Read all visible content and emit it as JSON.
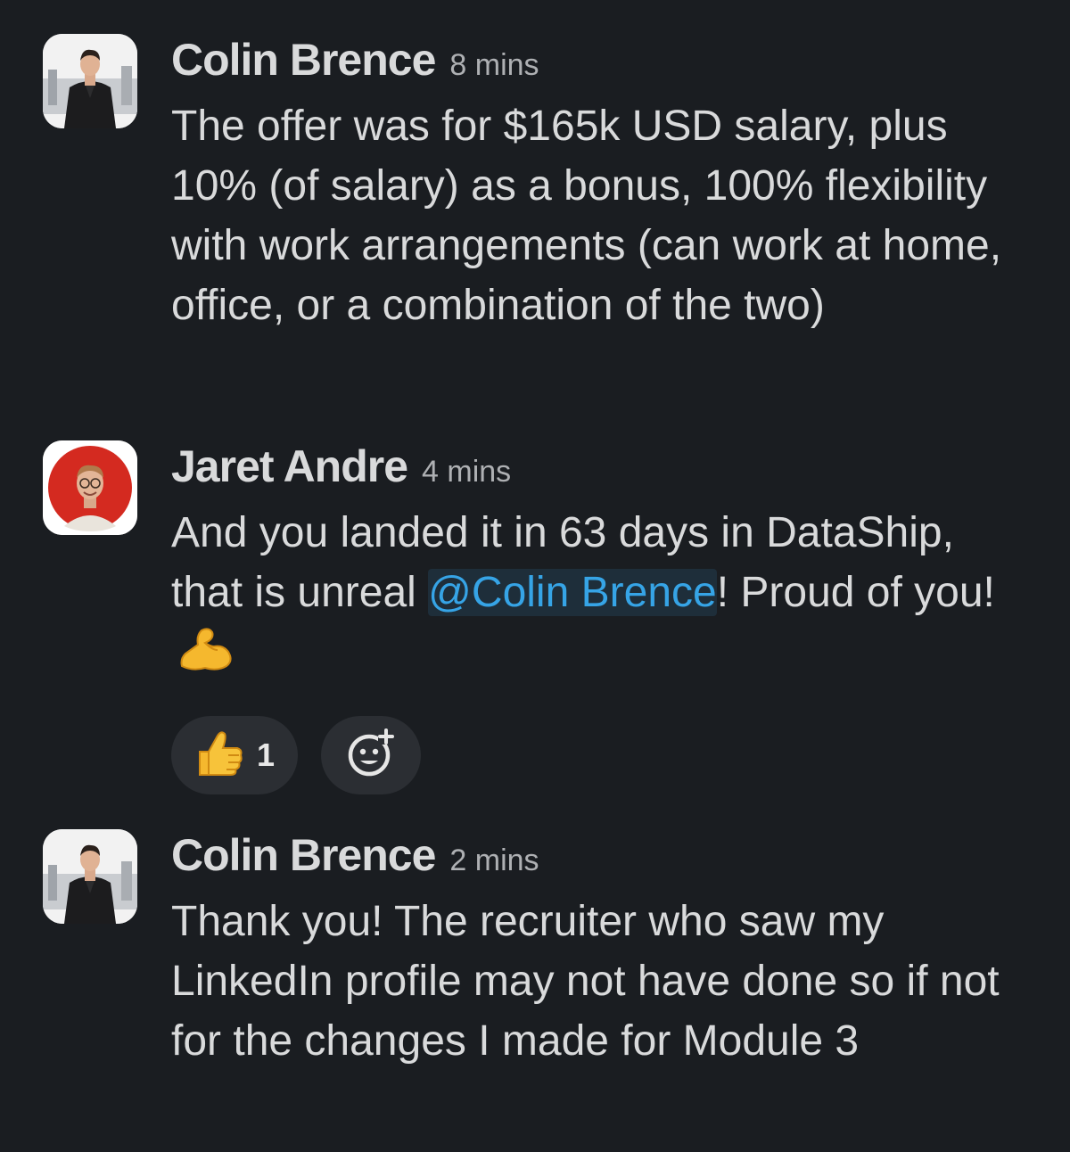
{
  "messages": [
    {
      "author": "Colin Brence",
      "time": "8 mins",
      "avatar": "colin-avatar",
      "text": "The offer was for $165k USD salary, plus 10% (of salary) as a bonus, 100% flexibility with work arrangements (can work at home, office, or a combination of the two)"
    },
    {
      "author": "Jaret Andre",
      "time": "4 mins",
      "avatar": "jaret-avatar",
      "text_before": "And you landed it in 63 days in DataShip, that is unreal ",
      "mention": "@Colin Brence",
      "text_after": "! Proud of you! ",
      "emoji": "flexed-biceps-icon",
      "reactions": [
        {
          "emoji": "thumbs-up-icon",
          "count": "1"
        }
      ],
      "add_reaction_icon": "add-reaction-icon"
    },
    {
      "author": "Colin Brence",
      "time": "2 mins",
      "avatar": "colin-avatar",
      "text": "Thank you! The recruiter who saw my LinkedIn profile may not have done so if not for the changes I made for Module 3"
    }
  ],
  "colors": {
    "background": "#1a1d21",
    "text": "#d9dadb",
    "mention": "#36a4e6",
    "reaction_bg": "#2b2e33"
  }
}
